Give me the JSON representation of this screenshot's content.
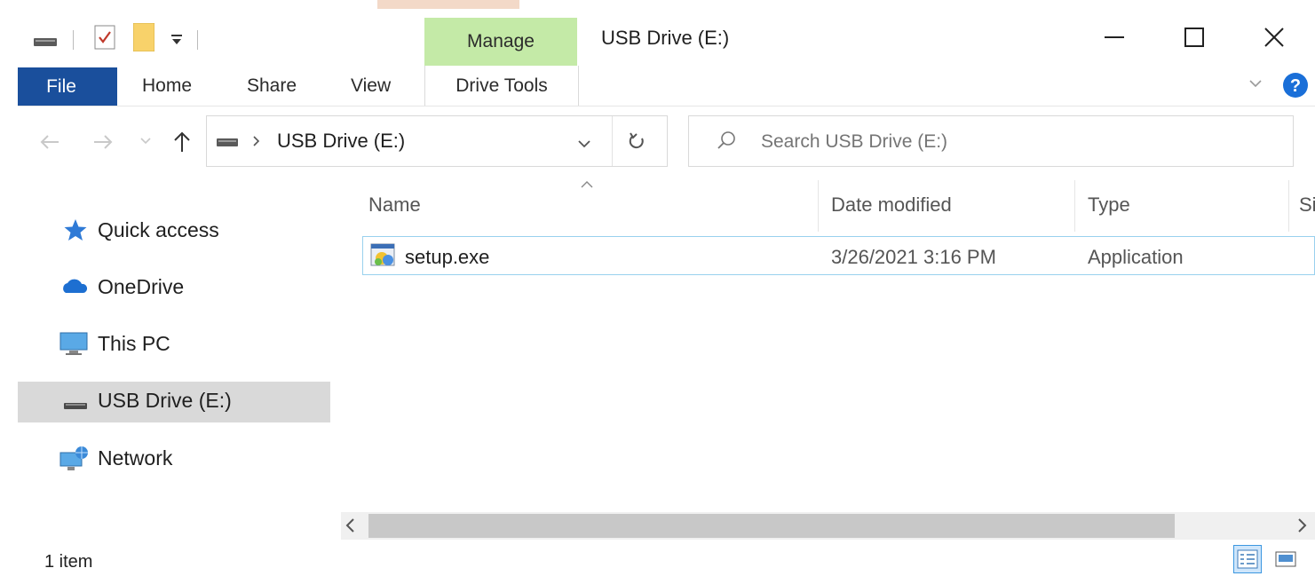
{
  "window": {
    "title": "USB Drive (E:)",
    "context_group_label": "Manage"
  },
  "ribbon": {
    "tabs": [
      "File",
      "Home",
      "Share",
      "View",
      "Drive Tools"
    ]
  },
  "address_bar": {
    "segments": [
      "USB Drive (E:)"
    ]
  },
  "search": {
    "placeholder": "Search USB Drive (E:)"
  },
  "nav_pane": {
    "items": [
      {
        "label": "Quick access",
        "icon": "star-icon"
      },
      {
        "label": "OneDrive",
        "icon": "cloud-icon"
      },
      {
        "label": "This PC",
        "icon": "monitor-icon"
      },
      {
        "label": "USB Drive (E:)",
        "icon": "drive-icon",
        "selected": true
      },
      {
        "label": "Network",
        "icon": "network-icon"
      }
    ]
  },
  "file_list": {
    "columns": [
      "Name",
      "Date modified",
      "Type",
      "Si"
    ],
    "sort_column": "Name",
    "sort_direction": "ascending",
    "rows": [
      {
        "name": "setup.exe",
        "date_modified": "3/26/2021 3:16 PM",
        "type": "Application",
        "icon": "setup-exe-icon"
      }
    ]
  },
  "status_bar": {
    "item_count": "1 item"
  },
  "colors": {
    "file_tab": "#1a4f9c",
    "manage_tab": "#c4eaa7",
    "selection_border": "#99d1ee",
    "nav_selected": "#d9d9d9",
    "help_icon": "#1a6fd8"
  }
}
